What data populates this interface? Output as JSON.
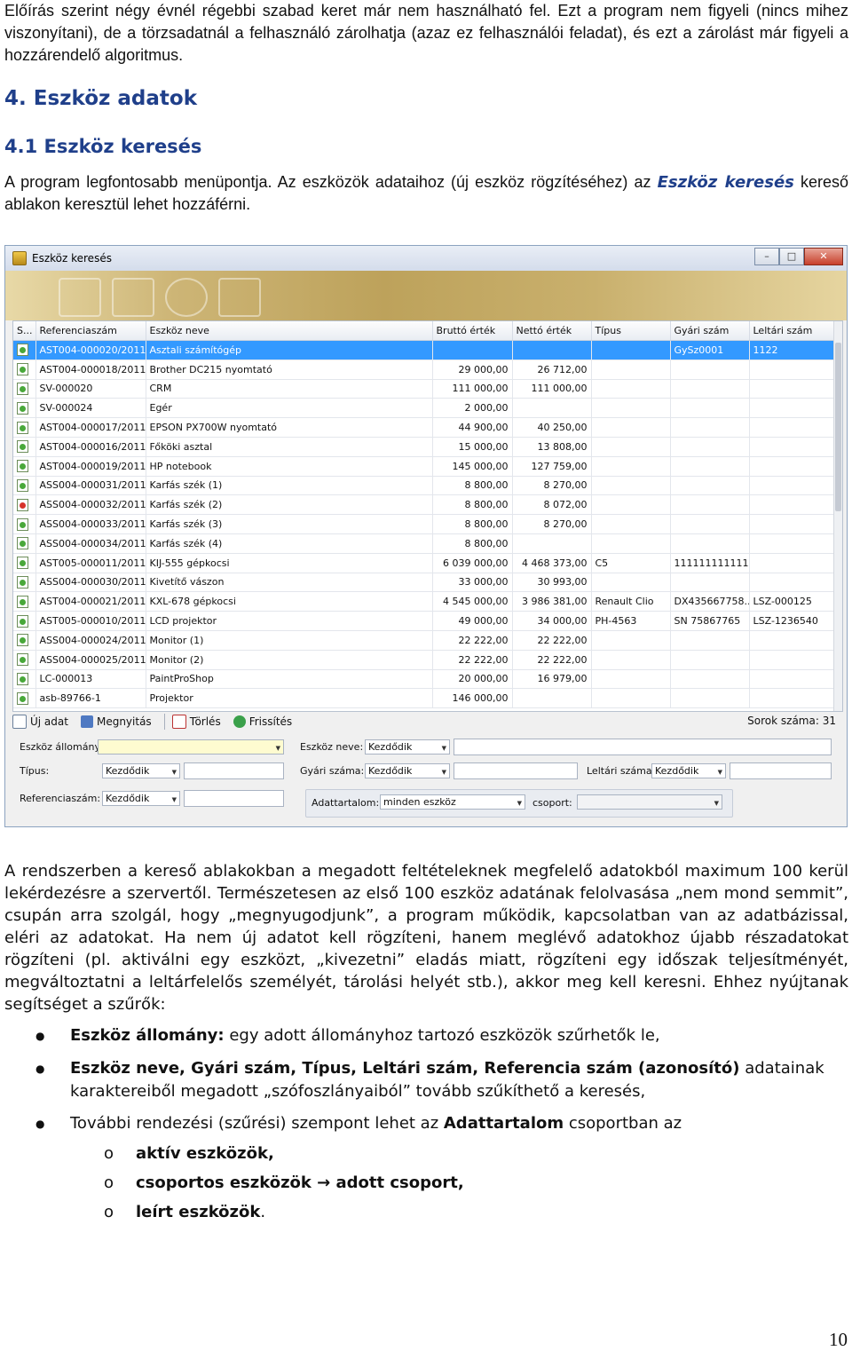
{
  "intro": {
    "line1": "Előírás szerint négy évnél régebbi szabad keret már nem használható fel. Ezt a program nem figyeli (nincs mihez viszonyítani), de a törzsadatnál a felhasználó zárolhatja (azaz ez felhasználói feladat), és ezt a zárolást már figyeli a hozzárendelő algoritmus."
  },
  "heading1": "4. Eszköz adatok",
  "heading2": "4.1 Eszköz keresés",
  "para1": {
    "before": "A program legfontosabb menüpontja. Az eszközök adataihoz (új eszköz rögzítéséhez) az ",
    "emph": "Eszköz keresés",
    "after": " kereső ablakon keresztül lehet hozzáférni."
  },
  "window": {
    "title": "Eszköz keresés",
    "controls": [
      "–",
      "□",
      "✕"
    ],
    "columns": [
      "S...",
      "Referenciaszám",
      "Eszköz neve",
      "Bruttó érték",
      "Nettó érték",
      "Típus",
      "Gyári szám",
      "Leltári szám"
    ],
    "rows": [
      {
        "status": "green",
        "ref": "AST004-000020/2011",
        "name": "Asztali számítógép",
        "gross": "",
        "net": "",
        "type": "",
        "serial": "GySz0001",
        "inv": "1122",
        "selected": true
      },
      {
        "status": "green",
        "ref": "AST004-000018/2011",
        "name": "Brother DC215 nyomtató",
        "gross": "29 000,00",
        "net": "26 712,00",
        "type": "",
        "serial": "",
        "inv": ""
      },
      {
        "status": "green",
        "ref": "SV-000020",
        "name": "CRM",
        "gross": "111 000,00",
        "net": "111 000,00",
        "type": "",
        "serial": "",
        "inv": ""
      },
      {
        "status": "green",
        "ref": "SV-000024",
        "name": "Egér",
        "gross": "2 000,00",
        "net": "",
        "type": "",
        "serial": "",
        "inv": ""
      },
      {
        "status": "green",
        "ref": "AST004-000017/2011",
        "name": "EPSON PX700W nyomtató",
        "gross": "44 900,00",
        "net": "40 250,00",
        "type": "",
        "serial": "",
        "inv": ""
      },
      {
        "status": "green",
        "ref": "AST004-000016/2011",
        "name": "Főköki asztal",
        "gross": "15 000,00",
        "net": "13 808,00",
        "type": "",
        "serial": "",
        "inv": ""
      },
      {
        "status": "green",
        "ref": "AST004-000019/2011",
        "name": "HP notebook",
        "gross": "145 000,00",
        "net": "127 759,00",
        "type": "",
        "serial": "",
        "inv": ""
      },
      {
        "status": "green",
        "ref": "ASS004-000031/2011",
        "name": "Karfás szék (1)",
        "gross": "8 800,00",
        "net": "8 270,00",
        "type": "",
        "serial": "",
        "inv": ""
      },
      {
        "status": "red",
        "ref": "ASS004-000032/2011",
        "name": "Karfás szék (2)",
        "gross": "8 800,00",
        "net": "8 072,00",
        "type": "",
        "serial": "",
        "inv": ""
      },
      {
        "status": "green",
        "ref": "ASS004-000033/2011",
        "name": "Karfás szék (3)",
        "gross": "8 800,00",
        "net": "8 270,00",
        "type": "",
        "serial": "",
        "inv": ""
      },
      {
        "status": "green",
        "ref": "ASS004-000034/2011",
        "name": "Karfás szék (4)",
        "gross": "8 800,00",
        "net": "",
        "type": "",
        "serial": "",
        "inv": ""
      },
      {
        "status": "green",
        "ref": "AST005-000011/2011",
        "name": "KIJ-555 gépkocsi",
        "gross": "6 039 000,00",
        "net": "4 468 373,00",
        "type": "C5",
        "serial": "1111111111111",
        "inv": ""
      },
      {
        "status": "green",
        "ref": "ASS004-000030/2011",
        "name": "Kivetítő vászon",
        "gross": "33 000,00",
        "net": "30 993,00",
        "type": "",
        "serial": "",
        "inv": ""
      },
      {
        "status": "green",
        "ref": "AST004-000021/2011",
        "name": "KXL-678 gépkocsi",
        "gross": "4 545 000,00",
        "net": "3 986 381,00",
        "type": "Renault Clio",
        "serial": "DX435667758...",
        "inv": "LSZ-000125"
      },
      {
        "status": "green",
        "ref": "AST005-000010/2011",
        "name": "LCD projektor",
        "gross": "49 000,00",
        "net": "34 000,00",
        "type": "PH-4563",
        "serial": "SN 75867765",
        "inv": "LSZ-1236540"
      },
      {
        "status": "green",
        "ref": "ASS004-000024/2011",
        "name": "Monitor (1)",
        "gross": "22 222,00",
        "net": "22 222,00",
        "type": "",
        "serial": "",
        "inv": ""
      },
      {
        "status": "green",
        "ref": "ASS004-000025/2011",
        "name": "Monitor (2)",
        "gross": "22 222,00",
        "net": "22 222,00",
        "type": "",
        "serial": "",
        "inv": ""
      },
      {
        "status": "green",
        "ref": "LC-000013",
        "name": "PaintProShop",
        "gross": "20 000,00",
        "net": "16 979,00",
        "type": "",
        "serial": "",
        "inv": ""
      },
      {
        "status": "green",
        "ref": "asb-89766-1",
        "name": "Projektor",
        "gross": "146 000,00",
        "net": "",
        "type": "",
        "serial": "",
        "inv": ""
      }
    ],
    "toolbar": {
      "new": "Új adat",
      "open": "Megnyitás",
      "delete": "Törlés",
      "refresh": "Frissítés",
      "rowcount_label": "Sorok száma:",
      "rowcount": "31"
    },
    "filters": {
      "stock_label": "Eszköz állomány:",
      "name_label": "Eszköz neve:",
      "name_mode": "Kezdődik",
      "type_label": "Típus:",
      "type_mode": "Kezdődik",
      "serial_label": "Gyári száma:",
      "serial_mode": "Kezdődik",
      "inv_label": "Leltári száma:",
      "inv_mode": "Kezdődik",
      "ref_label": "Referenciaszám:",
      "ref_mode": "Kezdődik",
      "content_label": "Adattartalom:",
      "content_value": "minden eszköz",
      "group_label": "csoport:"
    }
  },
  "para2": "A rendszerben a kereső ablakokban a megadott feltételeknek megfelelő adatokból maximum 100 kerül lekérdezésre a szervertől. Természetesen az első 100 eszköz adatának felolvasása „nem mond semmit”, csupán arra szolgál, hogy „megnyugodjunk”, a program működik, kapcsolatban van az adatbázissal, eléri az adatokat. Ha nem új adatot kell rögzíteni, hanem meglévő adatokhoz újabb részadatokat rögzíteni (pl. aktiválni egy eszközt, „kivezetni” eladás miatt, rögzíteni egy időszak teljesítményét, megváltoztatni a leltárfelelős személyét, tárolási helyét stb.), akkor meg kell keresni. Ehhez nyújtanak segítséget a szűrők:",
  "bullets": [
    {
      "bold": "Eszköz állomány:",
      "text": " egy adott állományhoz tartozó eszközök szűrhetők le,"
    },
    {
      "bold": "Eszköz neve, Gyári szám, Típus, Leltári szám, Referencia szám (azonosító)",
      "text": " adatainak karaktereiből megadott „szófoszlányaiból” tovább szűkíthető a keresés,"
    },
    {
      "pre": "További rendezési (szűrési) szempont lehet az ",
      "bold": "Adattartalom",
      "text": " csoportban az"
    }
  ],
  "subbullets": [
    "aktív eszközök,",
    "csoportos eszközök → adott csoport,",
    "leírt eszközök"
  ],
  "subbullet_last_punct": ".",
  "page_number": "10"
}
